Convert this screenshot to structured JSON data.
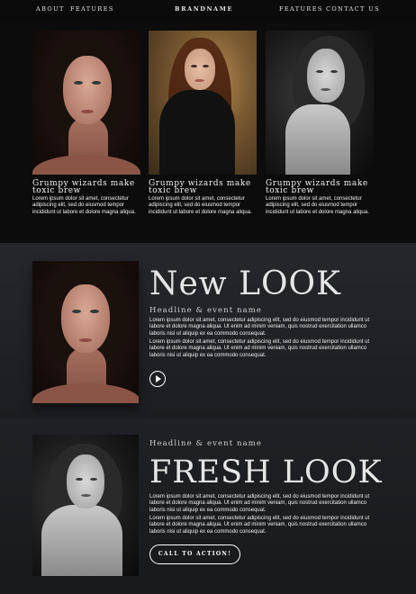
{
  "nav": {
    "left": [
      "ABOUT",
      "FEATURES"
    ],
    "brand": "BRANDNAME",
    "right": [
      "FEATURES",
      "CONTACT US"
    ]
  },
  "cards": [
    {
      "title": "Grumpy wizards make toxic brew",
      "text": "Lorem ipsum dolor sit amet, consectetur adipiscing elit, sed do eiusmod tempor incididunt ut labore et dolore magna aliqua."
    },
    {
      "title": "Grumpy wizards make toxic brew",
      "text": "Lorem ipsum dolor sit amet, consectetur adipiscing elit, sed do eiusmod tempor incididunt ut labore et dolore magna aliqua."
    },
    {
      "title": "Grumpy wizards make toxic brew",
      "text": "Lorem ipsum dolor sit amet, consectetur adipiscing elit, sed do eiusmod tempor incididunt ut labore et dolore magna aliqua."
    }
  ],
  "new_look": {
    "title": "New LOOK",
    "headline": "Headline & event name",
    "para1": "Lorem ipsum dolor sit amet, consectetur adipiscing elit, sed do eiusmod tempor incididunt ut labore et dolore magna aliqua. Ut enim ad minim veniam, quis nostrud exercitation ullamco laboris nisi ut aliquip ex ea commodo consequat.",
    "para2": "Lorem ipsum dolor sit amet, consectetur adipiscing elit, sed do eiusmod tempor incididunt ut labore et dolore magna aliqua. Ut enim ad minim veniam, quis nostrud exercitation ullamco laboris nisi ut aliquip ex ea commodo consequat.",
    "play_icon": "play-circle-icon"
  },
  "fresh_look": {
    "headline": "Headline & event name",
    "title": "FRESH LOOK",
    "para1": "Lorem ipsum dolor sit amet, consectetur adipiscing elit, sed do eiusmod tempor incididunt ut labore et dolore magna aliqua. Ut enim ad minim veniam, quis nostrud exercitation ullamco laboris nisi ut aliquip ex ea commodo consequat.",
    "para2": "Lorem ipsum dolor sit amet, consectetur adipiscing elit, sed do eiusmod tempor incididunt ut labore et dolore magna aliqua. Ut enim ad minim veniam, quis nostrud exercitation ullamco laboris nisi ut aliquip ex ea commodo consequat.",
    "cta": "CALL TO ACTION!"
  }
}
